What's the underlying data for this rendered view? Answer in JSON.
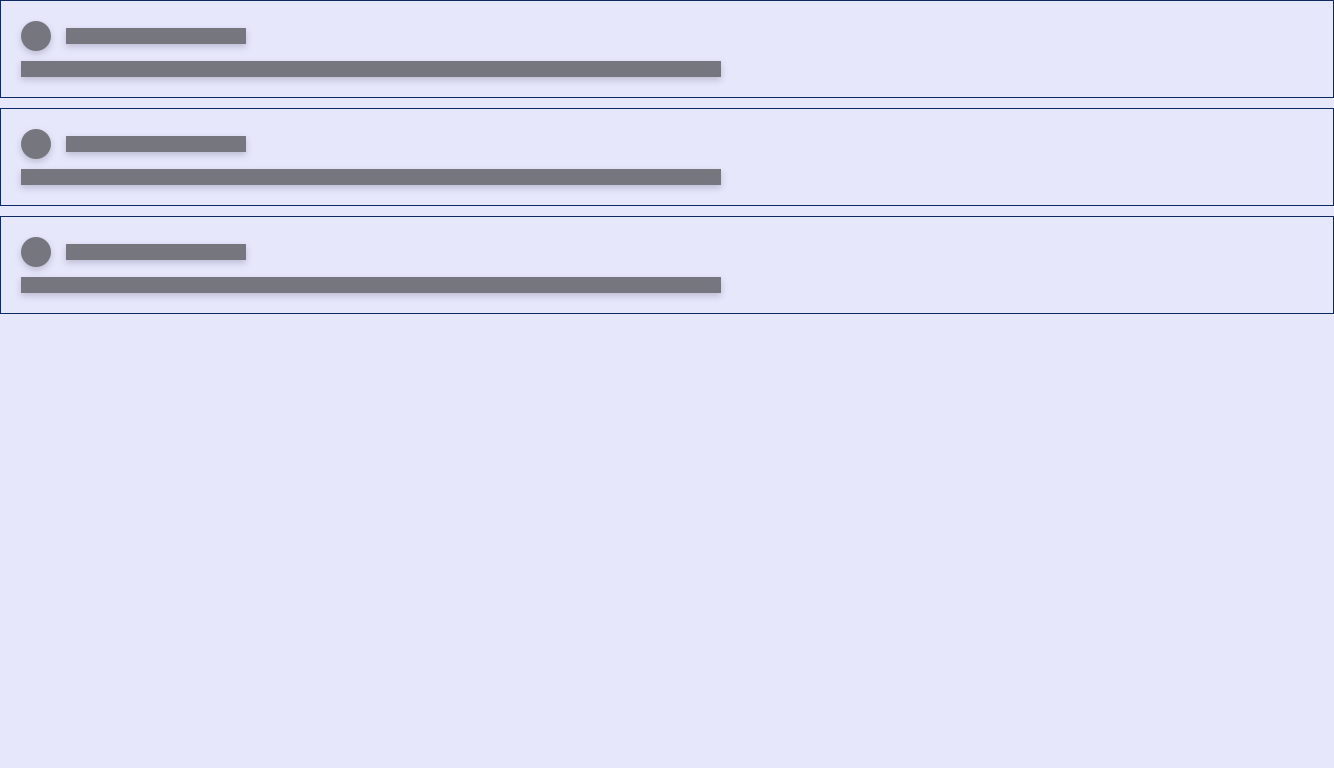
{
  "colors": {
    "background": "#e6e7fb",
    "card_border": "#0d2a63",
    "placeholder": "#76767f"
  },
  "skeleton_list": {
    "items": [
      {
        "avatar_icon": "avatar-placeholder",
        "title": "",
        "body": ""
      },
      {
        "avatar_icon": "avatar-placeholder",
        "title": "",
        "body": ""
      },
      {
        "avatar_icon": "avatar-placeholder",
        "title": "",
        "body": ""
      }
    ]
  }
}
